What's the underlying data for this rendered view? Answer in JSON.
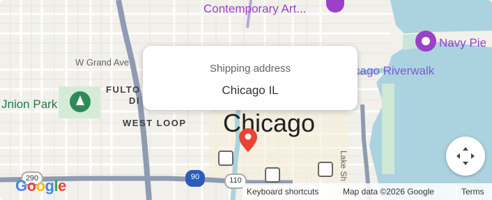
{
  "map": {
    "labels": {
      "contemporary_art": "Contemporary Art...",
      "navy_pier": "Navy Pie",
      "w_grand_ave": "W Grand Ave",
      "fulton": "FULTO",
      "fulton2": "DI",
      "union_park": "Jnion Park",
      "riverwalk": "cago Riverwalk",
      "west_loop": "WEST LOOP",
      "city": "Chicago",
      "lake_shore": "Lake Sh"
    },
    "popup": {
      "title": "Shipping address",
      "address": "Chicago IL"
    },
    "highways": {
      "i290": "290",
      "i90": "90",
      "us110": "110"
    },
    "colors": {
      "water": "#aad3df",
      "highway": "#8e9bb3",
      "park": "#d4ecd6",
      "marker": "#ea4335",
      "poi": "#9c3fc9"
    }
  },
  "footer": {
    "keyboard_shortcuts": "Keyboard shortcuts",
    "map_data": "Map data ©2026 Google",
    "terms": "Terms"
  },
  "logo": "Google"
}
